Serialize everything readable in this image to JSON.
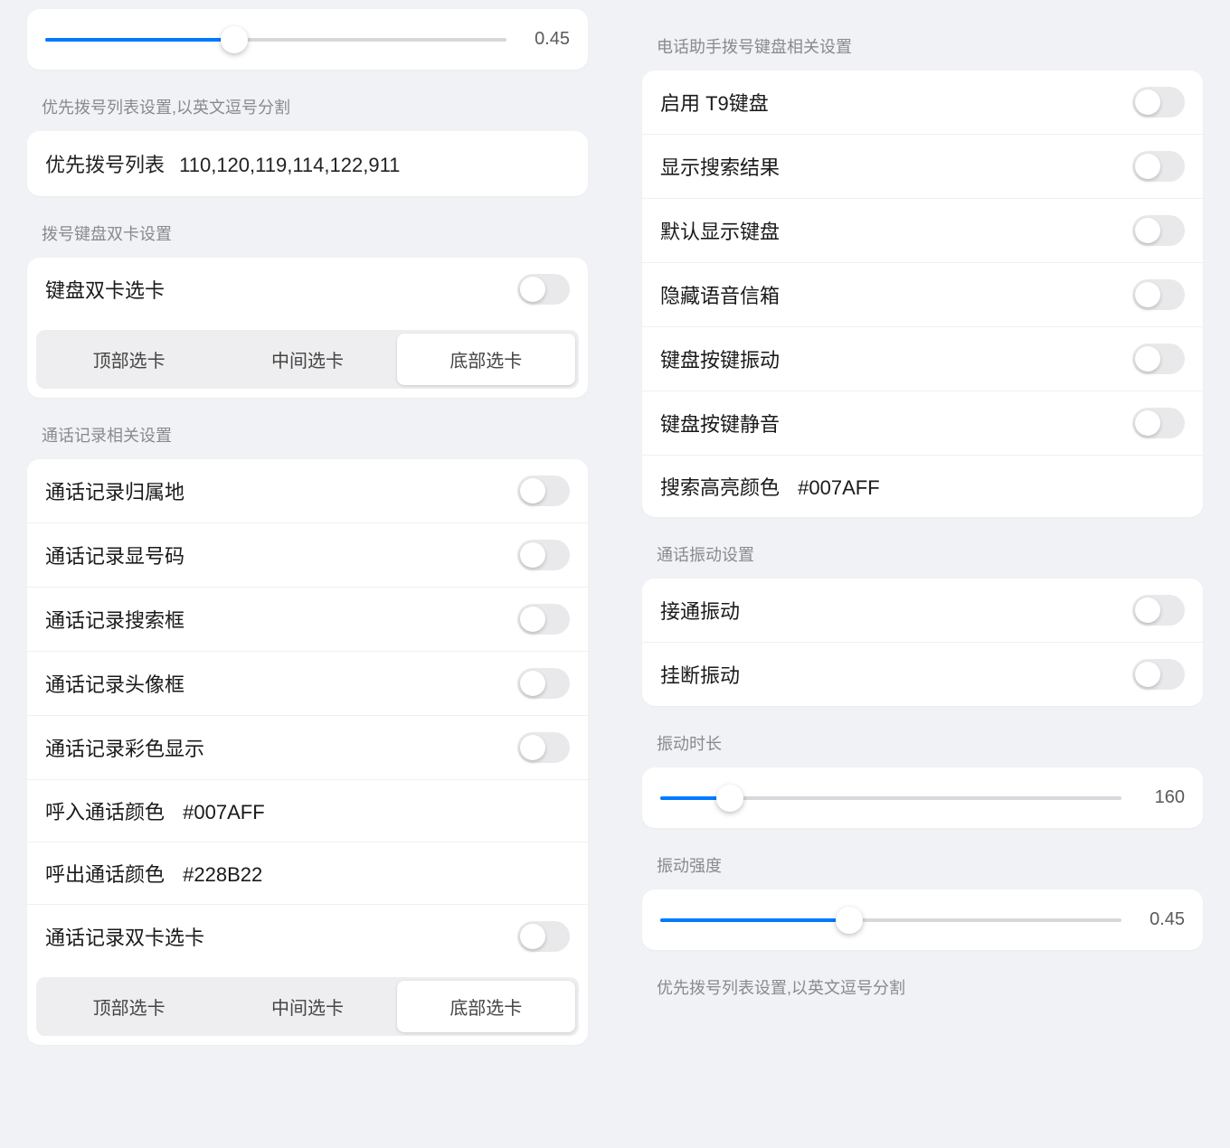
{
  "left": {
    "slider1": {
      "value": "0.45",
      "fill_pct": 41
    },
    "priority_section_title": "优先拨号列表设置,以英文逗号分割",
    "priority_label": "优先拨号列表",
    "priority_value": "110,120,119,114,122,911",
    "dualsim_section_title": "拨号键盘双卡设置",
    "dualsim_toggle_label": "键盘双卡选卡",
    "seg1": {
      "a": "顶部选卡",
      "b": "中间选卡",
      "c": "底部选卡"
    },
    "calllog_section_title": "通话记录相关设置",
    "calllog": {
      "r1": "通话记录归属地",
      "r2": "通话记录显号码",
      "r3": "通话记录搜索框",
      "r4": "通话记录头像框",
      "r5": "通话记录彩色显示",
      "incoming_label": "呼入通话颜色",
      "incoming_value": "#007AFF",
      "outgoing_label": "呼出通话颜色",
      "outgoing_value": "#228B22",
      "dualsim_label": "通话记录双卡选卡"
    },
    "seg2": {
      "a": "顶部选卡",
      "b": "中间选卡",
      "c": "底部选卡"
    }
  },
  "right": {
    "dialer_section_title": "电话助手拨号键盘相关设置",
    "dialer": {
      "r1": "启用 T9键盘",
      "r2": "显示搜索结果",
      "r3": "默认显示键盘",
      "r4": "隐藏语音信箱",
      "r5": "键盘按键振动",
      "r6": "键盘按键静音",
      "highlight_label": "搜索高亮颜色",
      "highlight_value": "#007AFF"
    },
    "vibration_section_title": "通话振动设置",
    "vibration": {
      "r1": "接通振动",
      "r2": "挂断振动"
    },
    "vib_duration_title": "振动时长",
    "vib_duration": {
      "value": "160",
      "fill_pct": 15
    },
    "vib_strength_title": "振动强度",
    "vib_strength": {
      "value": "0.45",
      "fill_pct": 41
    },
    "priority_section_title": "优先拨号列表设置,以英文逗号分割"
  }
}
